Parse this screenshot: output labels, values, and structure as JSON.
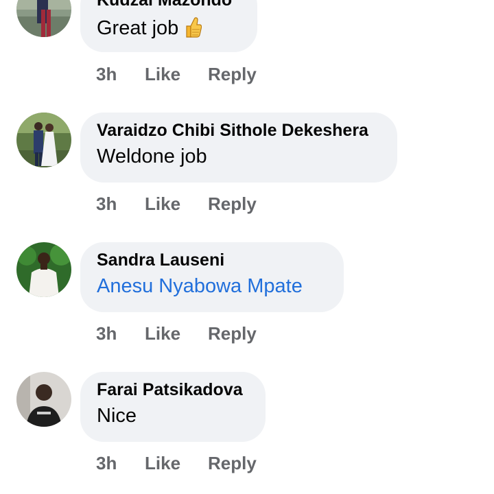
{
  "comments": [
    {
      "author": "Kudzai Mazondo",
      "text": "Great job",
      "emoji": "thumbs-up-icon",
      "time": "3h",
      "like_label": "Like",
      "reply_label": "Reply"
    },
    {
      "author": "Varaidzo Chibi Sithole Dekeshera",
      "text": "Weldone job",
      "time": "3h",
      "like_label": "Like",
      "reply_label": "Reply"
    },
    {
      "author": "Sandra Lauseni",
      "text": "Anesu Nyabowa Mpate",
      "text_is_mention": true,
      "time": "3h",
      "like_label": "Like",
      "reply_label": "Reply"
    },
    {
      "author": "Farai Patsikadova",
      "text": "Nice",
      "time": "3h",
      "like_label": "Like",
      "reply_label": "Reply"
    }
  ],
  "colors": {
    "bubble_background": "#f0f2f5",
    "text": "#050505",
    "meta": "#65676b",
    "mention": "#216fdb"
  }
}
